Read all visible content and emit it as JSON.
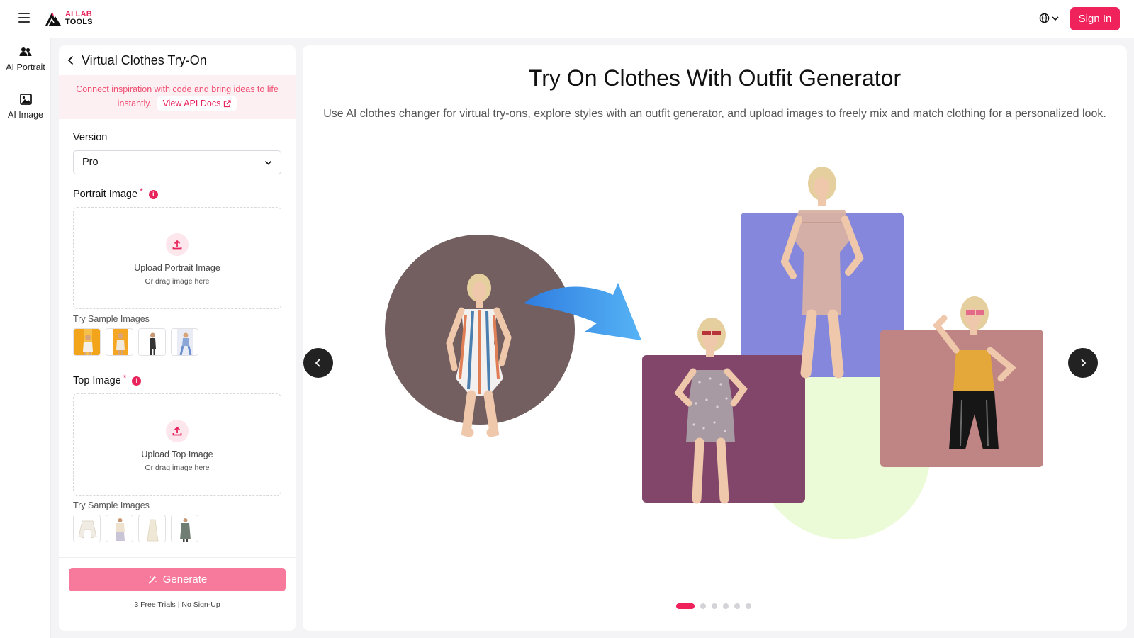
{
  "app": {
    "logo_line1": "AI LAB",
    "logo_line2": "TOOLS",
    "sign_in_label": "Sign In",
    "accent": "#f0225c"
  },
  "sidebar": {
    "items": [
      {
        "label": "AI Portrait",
        "icon": "users-icon"
      },
      {
        "label": "AI Image",
        "icon": "image-icon"
      }
    ]
  },
  "panel": {
    "title": "Virtual Clothes Try-On",
    "api_banner_text": "Connect inspiration with code and bring ideas to life instantly.",
    "api_link_label": "View API Docs",
    "version_label": "Version",
    "version_value": "Pro",
    "portrait": {
      "label": "Portrait Image",
      "required_mark": "*",
      "upload_title": "Upload Portrait Image",
      "upload_sub": "Or drag image here",
      "samples_label": "Try Sample Images"
    },
    "top": {
      "label": "Top Image",
      "required_mark": "*",
      "upload_title": "Upload Top Image",
      "upload_sub": "Or drag image here",
      "samples_label": "Try Sample Images"
    },
    "generate_label": "Generate",
    "trials_left": "3 Free Trials",
    "trials_sep": "|",
    "trials_right": "No Sign-Up"
  },
  "showcase": {
    "title": "Try On Clothes With Outfit Generator",
    "description": "Use AI clothes changer for virtual try-ons, explore styles with an outfit generator, and upload images to freely mix and match clothing for a personalized look.",
    "slide_count": 6,
    "active_slide": 1
  }
}
